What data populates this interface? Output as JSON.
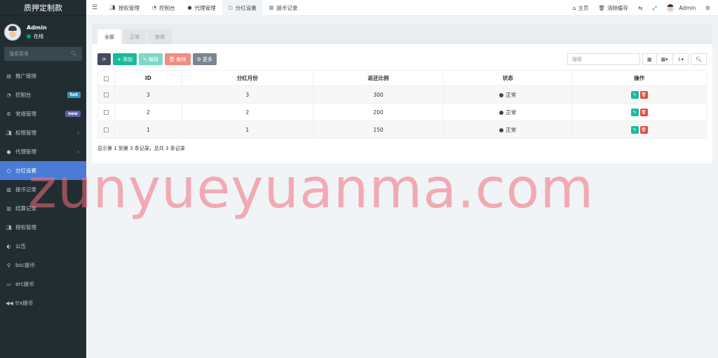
{
  "brand": "质押定制款",
  "user": {
    "name": "Admin",
    "status": "在线"
  },
  "sidebar": {
    "search_placeholder": "搜索菜单",
    "items": [
      {
        "label": "推广链接",
        "icon": "list-icon"
      },
      {
        "label": "控制台",
        "icon": "dashboard-icon",
        "badge": "hot"
      },
      {
        "label": "常规管理",
        "icon": "cogs-icon",
        "badge": "new"
      },
      {
        "label": "权限管理",
        "icon": "group-icon",
        "chevron": "‹"
      },
      {
        "label": "代理管理",
        "icon": "user-icon",
        "chevron": "‹"
      },
      {
        "label": "分红设置",
        "icon": "circle-icon",
        "active": true
      },
      {
        "label": "提币记录",
        "icon": "bar-icon"
      },
      {
        "label": "结算记录",
        "icon": "bar-icon"
      },
      {
        "label": "授权管理",
        "icon": "users-icon"
      },
      {
        "label": "公告",
        "icon": "half-circle-icon"
      },
      {
        "label": "bsc提币",
        "icon": "bicycle-icon"
      },
      {
        "label": "erc提币",
        "icon": "briefcase-icon"
      },
      {
        "label": "trx提币",
        "icon": "backward-icon"
      }
    ]
  },
  "topnav": {
    "tabs": [
      {
        "label": "授权管理",
        "icon": "users-icon"
      },
      {
        "label": "控制台",
        "icon": "dashboard-icon"
      },
      {
        "label": "代理管理",
        "icon": "user-icon"
      },
      {
        "label": "分红设置",
        "icon": "circle-icon",
        "active": true
      },
      {
        "label": "提币记录",
        "icon": "bar-icon"
      }
    ],
    "home": "主页",
    "clear_cache": "清除缓存",
    "admin": "Admin"
  },
  "panel": {
    "tabs": [
      "全部",
      "正常",
      "禁用"
    ],
    "buttons": {
      "add": "添加",
      "edit": "编辑",
      "delete": "删除",
      "more": "更多"
    },
    "search_placeholder": "搜索",
    "columns": [
      "ID",
      "分红月份",
      "返还比例",
      "状态",
      "操作"
    ],
    "rows": [
      {
        "id": "3",
        "month": "3",
        "ratio": "300",
        "status": "正常"
      },
      {
        "id": "2",
        "month": "2",
        "ratio": "200",
        "status": "正常"
      },
      {
        "id": "1",
        "month": "1",
        "ratio": "150",
        "status": "正常"
      }
    ],
    "footer": "显示第 1 到第 3 条记录，总共 3 条记录"
  },
  "watermark": "zunyueyuanma.com",
  "colors": {
    "sidebar_bg": "#222d32",
    "active": "#4a7bd6",
    "add": "#18bc9c",
    "delete": "#e74c3c"
  }
}
